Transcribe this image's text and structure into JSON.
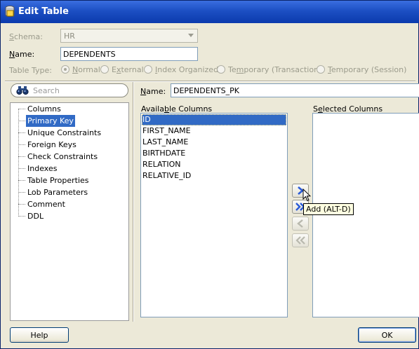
{
  "window": {
    "title": "Edit Table",
    "icon": "table-icon"
  },
  "form": {
    "schema_label": "Schema:",
    "schema_value": "HR",
    "name_label": "Name:",
    "name_value": "DEPENDENTS",
    "table_type_label": "Table Type:",
    "table_types": [
      "Normal",
      "External",
      "Index Organized",
      "Temporary (Transaction)",
      "Temporary (Session)"
    ],
    "selected_table_type": "Normal"
  },
  "search": {
    "placeholder": "Search",
    "icon": "binoculars-icon"
  },
  "nav": {
    "items": [
      "Columns",
      "Primary Key",
      "Unique Constraints",
      "Foreign Keys",
      "Check Constraints",
      "Indexes",
      "Table Properties",
      "Lob Parameters",
      "Comment",
      "DDL"
    ],
    "selected": "Primary Key"
  },
  "pk": {
    "name_label": "Name:",
    "name_value": "DEPENDENTS_PK",
    "available_label": "Available Columns",
    "selected_label": "Selected Columns",
    "available_columns": [
      "ID",
      "FIRST_NAME",
      "LAST_NAME",
      "BIRTHDATE",
      "RELATION",
      "RELATIVE_ID"
    ],
    "selected_columns": [],
    "highlighted_column": "ID"
  },
  "shuttle": {
    "add_icon": "chevron-right-icon",
    "add_all_icon": "double-chevron-right-icon",
    "remove_icon": "chevron-left-icon",
    "remove_all_icon": "double-chevron-left-icon",
    "tooltip": "Add (ALT-D)"
  },
  "buttons": {
    "help": "Help",
    "ok": "OK"
  },
  "colors": {
    "titlebar": "#1c4fc3",
    "selection": "#316ac5",
    "dialog_bg": "#ece9d8"
  }
}
